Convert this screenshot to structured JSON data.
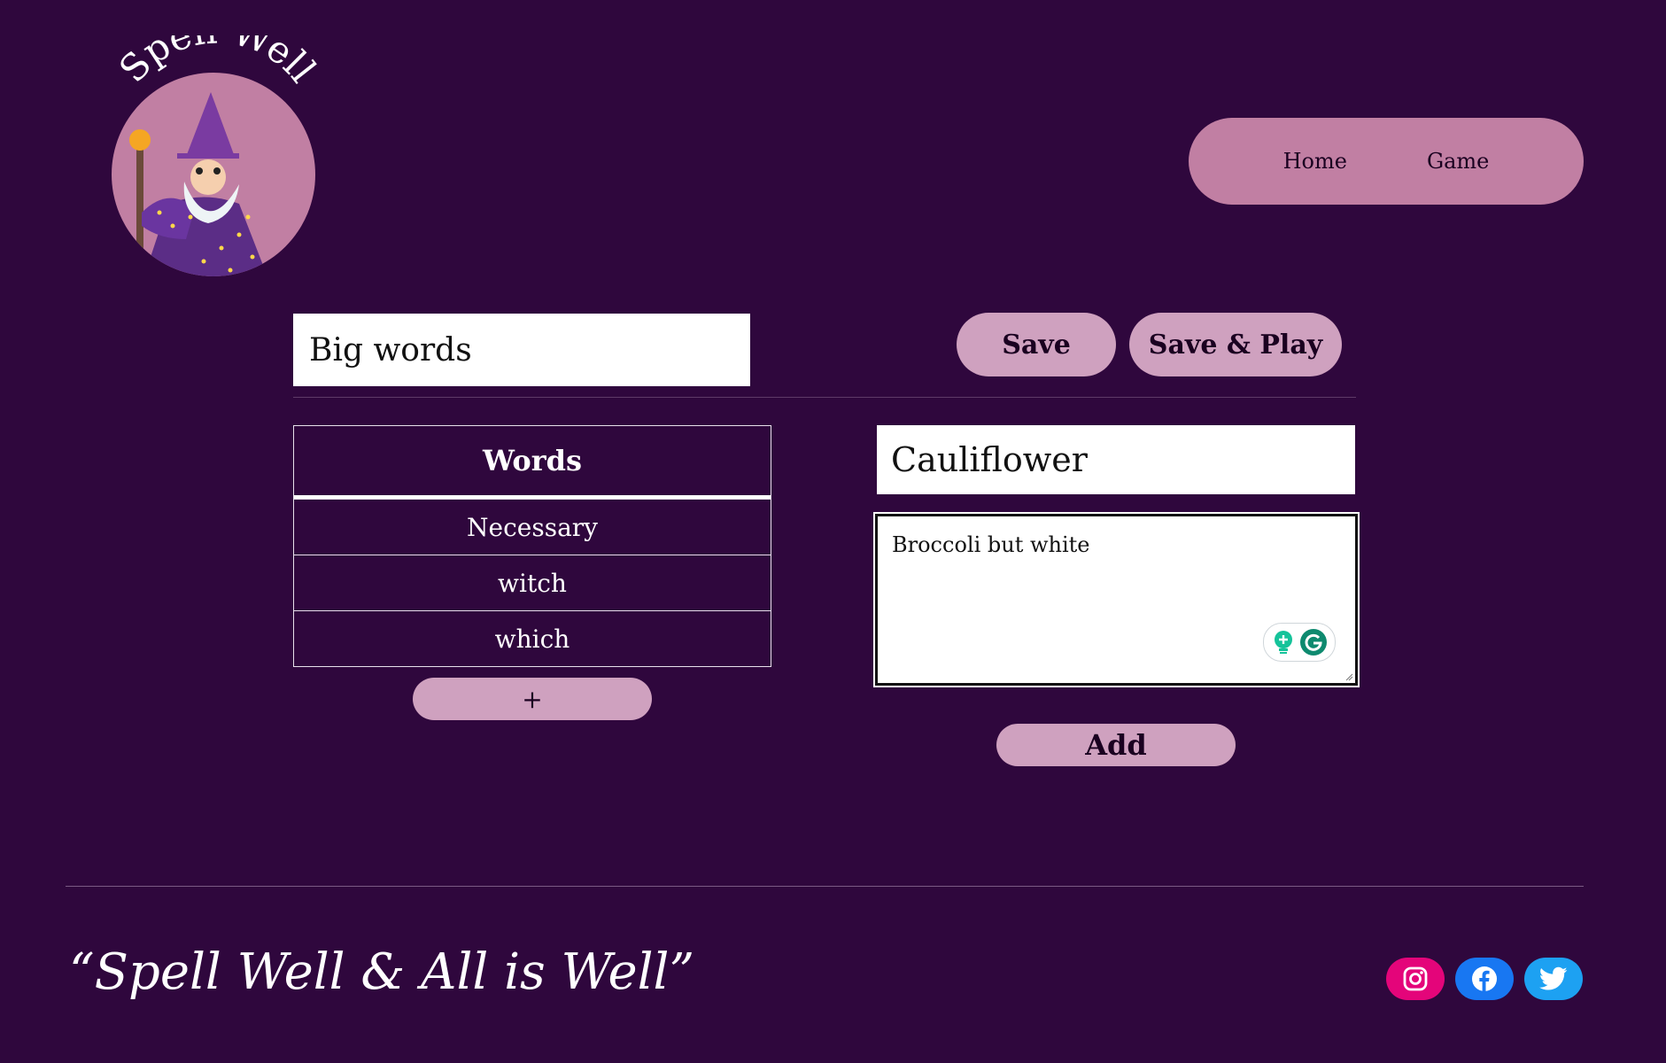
{
  "brand": {
    "logo_text": "Spell Well",
    "colors": {
      "background": "#2f073d",
      "nav_pill": "#c17fa3",
      "button": "#cfa1bf"
    }
  },
  "nav": {
    "items": [
      {
        "label": "Home"
      },
      {
        "label": "Game"
      }
    ]
  },
  "editor": {
    "list_title_value": "Big words",
    "save_label": "Save",
    "save_play_label": "Save & Play"
  },
  "words_table": {
    "header": "Words",
    "rows": [
      "Necessary",
      "witch",
      "which"
    ],
    "add_row_label": "+"
  },
  "word_form": {
    "word_value": "Cauliflower",
    "definition_value": "Broccoli but white",
    "add_label": "Add"
  },
  "footer": {
    "tagline": "“Spell Well & All is Well”",
    "social": [
      {
        "icon": "instagram-icon"
      },
      {
        "icon": "facebook-icon"
      },
      {
        "icon": "twitter-icon"
      }
    ]
  }
}
